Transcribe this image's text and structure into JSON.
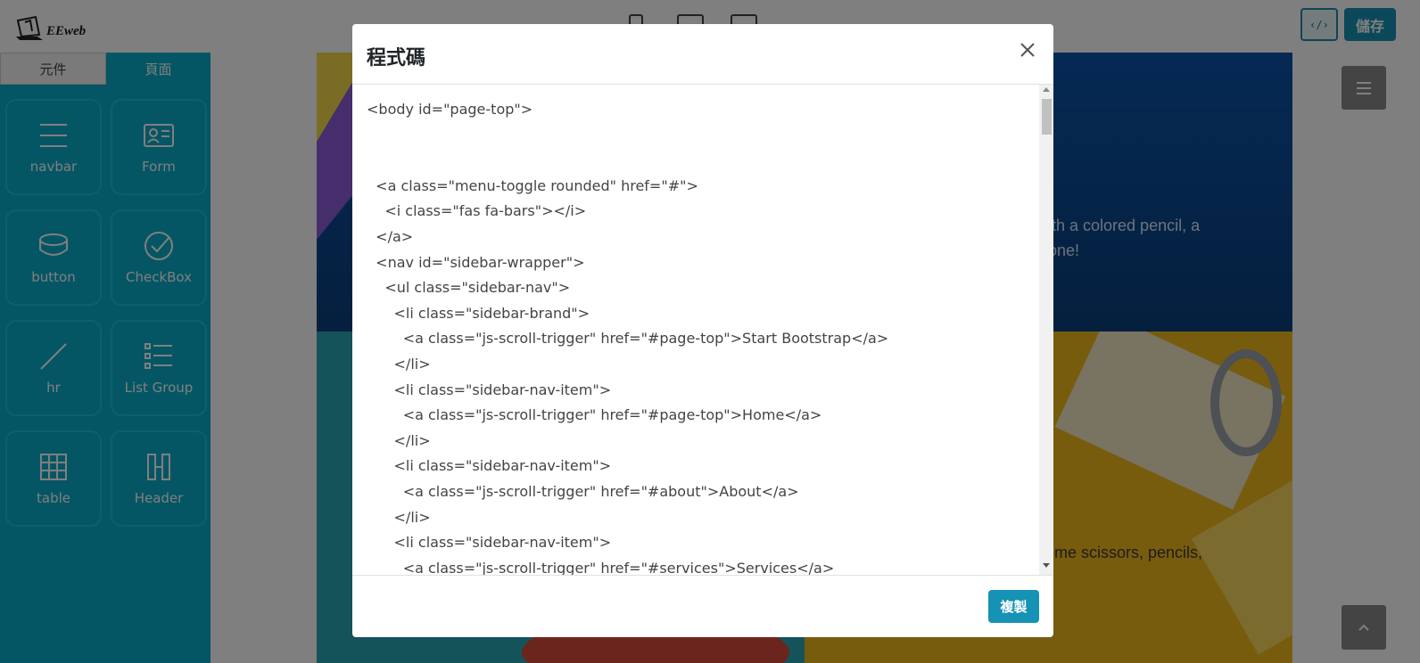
{
  "brand": {
    "logo_text": "EEweb"
  },
  "header": {
    "code_button_label": "‹/›",
    "save_label": "儲存"
  },
  "sidebar": {
    "tabs": [
      {
        "label": "元件",
        "active": false
      },
      {
        "label": "頁面",
        "active": true
      }
    ],
    "components": [
      {
        "label": "navbar",
        "icon": "menu-lines-icon"
      },
      {
        "label": "Form",
        "icon": "id-card-icon"
      },
      {
        "label": "button",
        "icon": "cylinder-icon"
      },
      {
        "label": "CheckBox",
        "icon": "check-circle-icon"
      },
      {
        "label": "hr",
        "icon": "diagonal-line-icon"
      },
      {
        "label": "List Group",
        "icon": "list-icon"
      },
      {
        "label": "table",
        "icon": "table-grid-icon"
      },
      {
        "label": "Header",
        "icon": "header-h-icon"
      }
    ]
  },
  "canvas": {
    "hero_text_lines": [
      "ith a colored pencil, a",
      "one!"
    ],
    "lower_text": "ome scissors, pencils,"
  },
  "modal": {
    "title": "程式碼",
    "code_lines": [
      "<body id=\"page-top\">",
      "",
      "",
      "  <a class=\"menu-toggle rounded\" href=\"#\">",
      "    <i class=\"fas fa-bars\"></i>",
      "  </a>",
      "  <nav id=\"sidebar-wrapper\">",
      "    <ul class=\"sidebar-nav\">",
      "      <li class=\"sidebar-brand\">",
      "        <a class=\"js-scroll-trigger\" href=\"#page-top\">Start Bootstrap</a>",
      "      </li>",
      "      <li class=\"sidebar-nav-item\">",
      "        <a class=\"js-scroll-trigger\" href=\"#page-top\">Home</a>",
      "      </li>",
      "      <li class=\"sidebar-nav-item\">",
      "        <a class=\"js-scroll-trigger\" href=\"#about\">About</a>",
      "      </li>",
      "      <li class=\"sidebar-nav-item\">",
      "        <a class=\"js-scroll-trigger\" href=\"#services\">Services</a>"
    ],
    "copy_label": "複製"
  },
  "colors": {
    "accent": "#1692b5",
    "sidebar": "#0aacc9"
  }
}
